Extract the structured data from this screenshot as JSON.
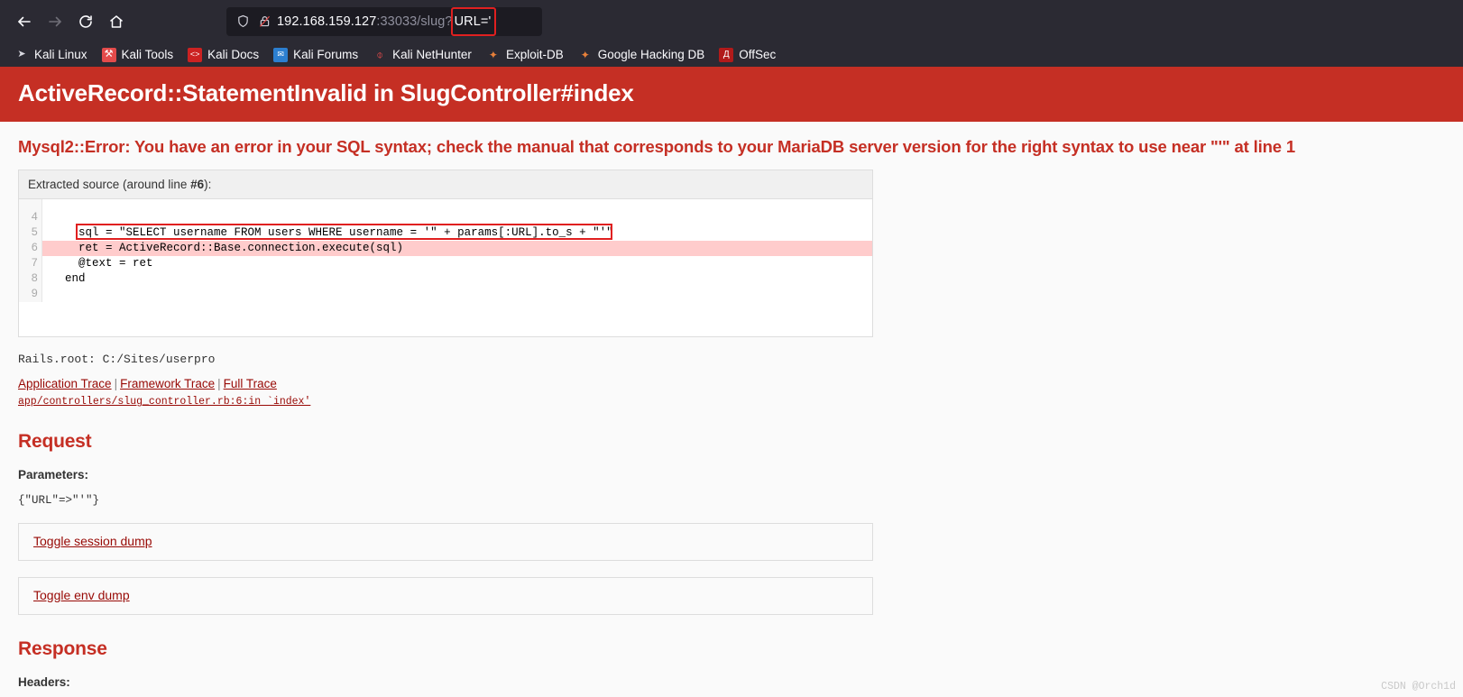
{
  "browser": {
    "nav": {
      "back_label": "Back",
      "forward_label": "Forward",
      "reload_label": "Reload",
      "home_label": "Home"
    },
    "urlbar": {
      "host": "192.168.159.127",
      "port_path": ":33033/slug?",
      "query_highlighted": "URL='",
      "shield_label": "Tracking protection",
      "lock_label": "Connection is not secure"
    },
    "bookmarks": [
      {
        "label": "Kali Linux",
        "icon": "dragon-icon",
        "color": "#2a2a33",
        "glyph": "➤"
      },
      {
        "label": "Kali Tools",
        "icon": "tools-icon",
        "color": "#e34b4b",
        "glyph": "⚒"
      },
      {
        "label": "Kali Docs",
        "icon": "docs-icon",
        "color": "#cc2222",
        "glyph": "‹›"
      },
      {
        "label": "Kali Forums",
        "icon": "forums-icon",
        "color": "#2c7fd0",
        "glyph": "✉"
      },
      {
        "label": "Kali NetHunter",
        "icon": "nethunter-icon",
        "color": "#cc2222",
        "glyph": "⊘"
      },
      {
        "label": "Exploit-DB",
        "icon": "exploit-db-icon",
        "color": "#e8803a",
        "glyph": "◆"
      },
      {
        "label": "Google Hacking DB",
        "icon": "google-hacking-db-icon",
        "color": "#e8803a",
        "glyph": "◆"
      },
      {
        "label": "OffSec",
        "icon": "offsec-icon",
        "color": "#b11a1a",
        "glyph": "Д"
      }
    ]
  },
  "error": {
    "banner_title": "ActiveRecord::StatementInvalid in SlugController#index",
    "message": "Mysql2::Error: You have an error in your SQL syntax; check the manual that corresponds to your MariaDB server version for the right syntax to use near \"'\" at line 1",
    "banner_color": "#c52f24"
  },
  "source": {
    "header_prefix": "Extracted source (around line ",
    "header_line": "#6",
    "header_suffix": "):",
    "line_numbers": [
      "4",
      "5",
      "6",
      "7",
      "8",
      "9"
    ],
    "lines": [
      "",
      "    sql = \"SELECT username FROM users WHERE username = '\" + params[:URL].to_s + \"'\"",
      "    ret = ActiveRecord::Base.connection.execute(sql)",
      "    @text = ret",
      "  end",
      ""
    ],
    "highlight_index": 2,
    "boxed_index": 1
  },
  "rails_root": "Rails.root: C:/Sites/userpro",
  "traces": {
    "application": "Application Trace",
    "framework": "Framework Trace",
    "full": "Full Trace",
    "separator": "|",
    "path": "app/controllers/slug_controller.rb:6:in `index'"
  },
  "request": {
    "title": "Request",
    "parameters_label": "Parameters:",
    "parameters_value": "{\"URL\"=>\"'\"}",
    "toggle_session": "Toggle session dump",
    "toggle_env": "Toggle env dump"
  },
  "response": {
    "title": "Response",
    "headers_label": "Headers:"
  },
  "watermark": "CSDN @Orch1d"
}
